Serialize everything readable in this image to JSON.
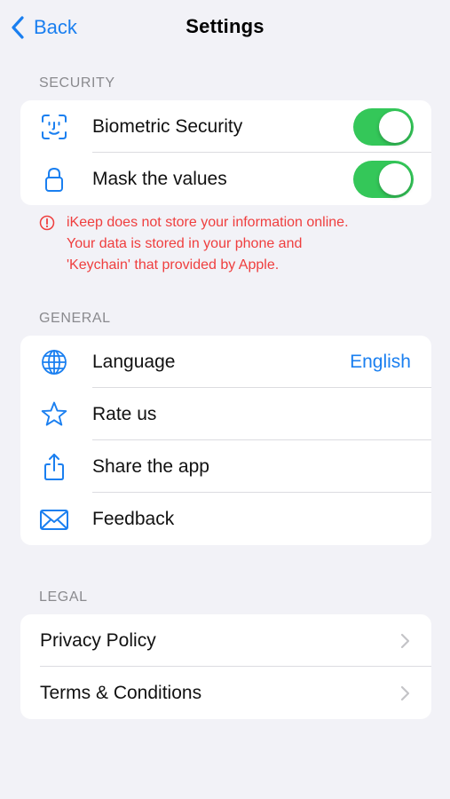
{
  "nav": {
    "back_label": "Back",
    "title": "Settings"
  },
  "security": {
    "header": "SECURITY",
    "items": [
      {
        "label": "Biometric Security",
        "icon": "face-id-icon",
        "toggle_on": true
      },
      {
        "label": "Mask the values",
        "icon": "lock-icon",
        "toggle_on": true
      }
    ]
  },
  "warning": {
    "lines": [
      "iKeep does not store your information online.",
      "Your data is stored in your phone and",
      "'Keychain' that provided by Apple."
    ]
  },
  "general": {
    "header": "GENERAL",
    "items": [
      {
        "label": "Language",
        "icon": "globe-icon",
        "value": "English"
      },
      {
        "label": "Rate us",
        "icon": "star-icon"
      },
      {
        "label": "Share the app",
        "icon": "share-icon"
      },
      {
        "label": "Feedback",
        "icon": "envelope-icon"
      }
    ]
  },
  "legal": {
    "header": "LEGAL",
    "items": [
      {
        "label": "Privacy Policy",
        "icon": "chevron-right-icon"
      },
      {
        "label": "Terms & Conditions",
        "icon": "chevron-right-icon"
      }
    ]
  },
  "colors": {
    "accent": "#1a7ff0",
    "toggle_on": "#34c759",
    "warning": "#ef3e3e",
    "background": "#f2f2f7"
  }
}
